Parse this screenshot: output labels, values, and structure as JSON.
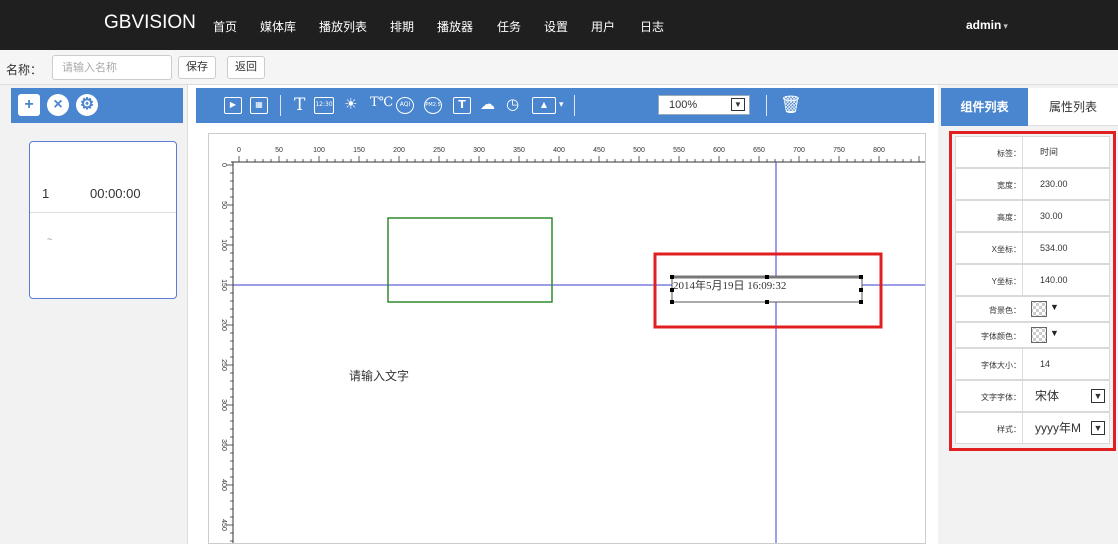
{
  "navbar": {
    "brand": "GBVISION",
    "items": [
      "首页",
      "媒体库",
      "播放列表",
      "排期",
      "播放器",
      "任务",
      "设置",
      "用户",
      "日志"
    ],
    "user": "admin"
  },
  "namebar": {
    "label": "名称：",
    "placeholder": "请输入名称",
    "save": "保存",
    "back": "返回"
  },
  "pages": [
    {
      "num": "1",
      "time": "00:00:00",
      "sub": "~"
    }
  ],
  "toolbar": {
    "zoom": "100%"
  },
  "ruler": {
    "x_labels": [
      "0",
      "50",
      "100",
      "150",
      "200",
      "250",
      "300",
      "350",
      "400",
      "450",
      "500",
      "550",
      "600",
      "650",
      "700",
      "750",
      "800"
    ],
    "y_labels": [
      "0",
      "50",
      "100",
      "150",
      "200",
      "250",
      "300",
      "350",
      "400",
      "450"
    ]
  },
  "canvas": {
    "text_widget": "请输入文字",
    "time_widget": "2014年5月19日 16:09:32"
  },
  "tabs": {
    "components": "组件列表",
    "properties": "属性列表"
  },
  "properties": [
    {
      "label": "标签：",
      "value": "时间"
    },
    {
      "label": "宽度：",
      "value": "230.00"
    },
    {
      "label": "高度：",
      "value": "30.00"
    },
    {
      "label": "X坐标：",
      "value": "534.00"
    },
    {
      "label": "Y坐标：",
      "value": "140.00"
    },
    {
      "label": "背景色：",
      "value": ""
    },
    {
      "label": "字体颜色：",
      "value": ""
    },
    {
      "label": "字体大小：",
      "value": "14"
    },
    {
      "label": "文字字体：",
      "value": "宋体"
    },
    {
      "label": "样式：",
      "value": "yyyy年M"
    }
  ],
  "colors": {
    "navbar": "#1f1f1f",
    "accent": "#4a86cf",
    "highlight": "#e02020",
    "guide_line": "#3b3bd6",
    "rect_green": "#2e8b2e"
  }
}
